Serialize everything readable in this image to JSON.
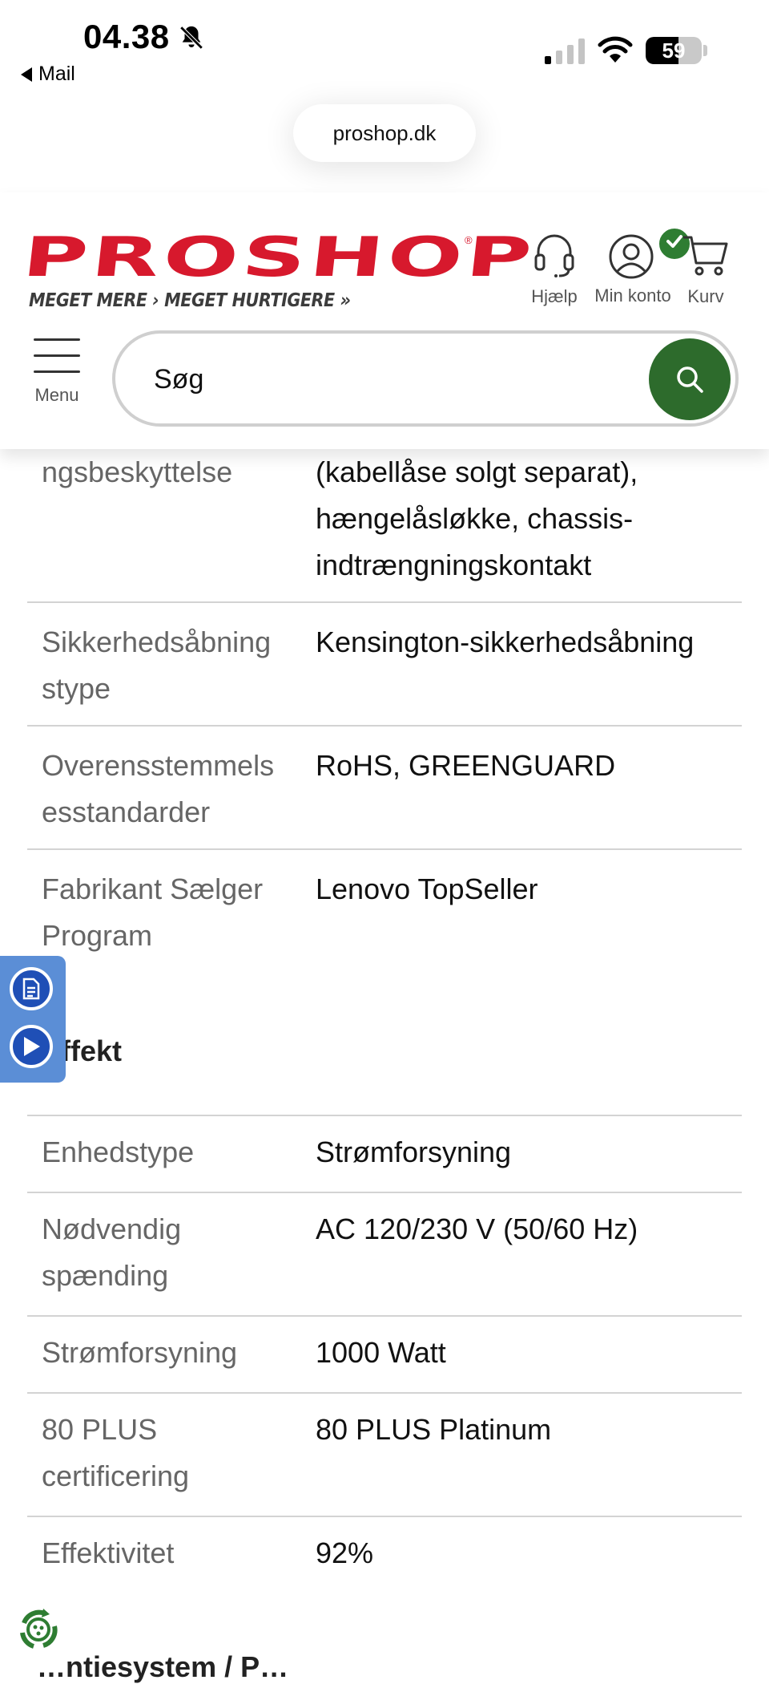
{
  "status_bar": {
    "time": "04.38",
    "back_app": "Mail",
    "battery_percent": "59",
    "battery_level": 0.59,
    "icons": [
      "bell-slash-icon",
      "signal-icon",
      "wifi-icon",
      "battery-icon"
    ]
  },
  "browser": {
    "url": "proshop.dk"
  },
  "header": {
    "logo_text": "PROSHOP",
    "tagline": "MEGET MERE › MEGET HURTIGERE »",
    "help_label": "Hjælp",
    "account_label": "Min konto",
    "cart_label": "Kurv",
    "menu_label": "Menu",
    "search_placeholder": "Søg",
    "colors": {
      "brand_red": "#d7192d",
      "search_green": "#2d6b2c",
      "badge_green": "#2e7d32"
    }
  },
  "specs": {
    "rows_top": [
      {
        "key": "ngsbeskyttelse",
        "value": "(kabellåse solgt separat), hængelåsløkke, chassis-indtrængningskontakt"
      },
      {
        "key": "Sikkerhedsåbning stype",
        "value": "Kensington-sikkerhedsåbning"
      },
      {
        "key": "Overensstemmels esstandarder",
        "value": "RoHS, GREENGUARD"
      },
      {
        "key": "Fabrikant Sælger Program",
        "value": "Lenovo TopSeller"
      }
    ],
    "section_title": "Effekt",
    "rows_effekt": [
      {
        "key": "Enhedstype",
        "value": "Strømforsyning"
      },
      {
        "key": "Nødvendig spænding",
        "value": "AC 120/230 V (50/60 Hz)"
      },
      {
        "key": "Strømforsyning",
        "value": "1000 Watt"
      },
      {
        "key": "80 PLUS certificering",
        "value": "80 PLUS Platinum"
      },
      {
        "key": "Effektivitet",
        "value": "92%"
      }
    ],
    "next_section_partial": "…ntiesystem / P…"
  }
}
